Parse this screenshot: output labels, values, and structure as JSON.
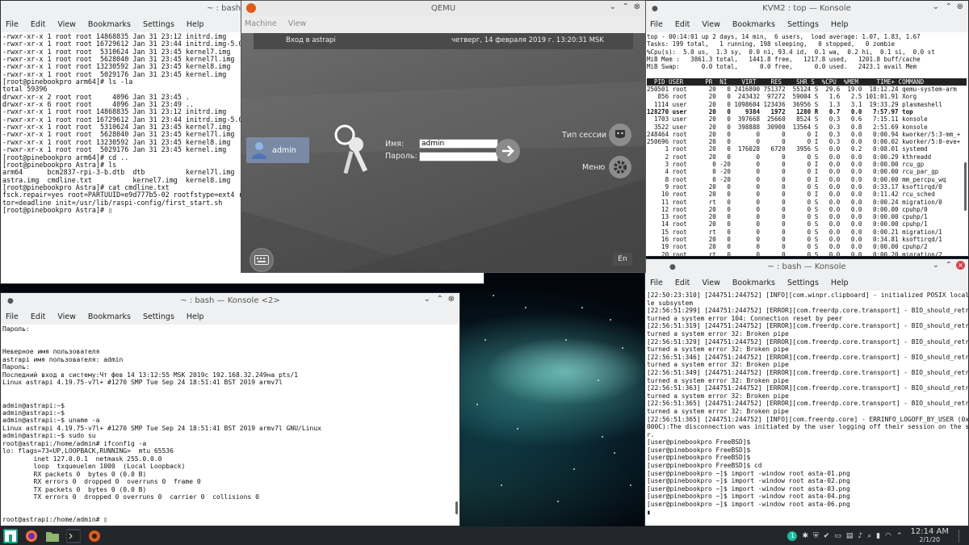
{
  "win_left_top": {
    "title": "~ : bash —",
    "menu": [
      "File",
      "Edit",
      "View",
      "Bookmarks",
      "Settings",
      "Help"
    ],
    "lines": [
      "-rwxr-xr-x 1 root root 14868835 Jan 31 23:12 initrd.img",
      "-rwxr-xr-x 1 root root 16729612 Jan 31 23:44 initrd.img-5.0.0-1017",
      "-rwxr-xr-x 1 root root  5310624 Jan 31 23:45 kernel7.img",
      "-rwxr-xr-x 1 root root  5628040 Jan 31 23:45 kernel7l.img",
      "-rwxr-xr-x 1 root root 13230592 Jan 31 23:45 kernel8.img",
      "-rwxr-xr-x 1 root root  5029176 Jan 31 23:45 kernel.img",
      "[root@pinebookpro arm64]# ls -la",
      "total 59396",
      "drwxr-xr-x 2 root root     4096 Jan 31 23:45 .",
      "drwxr-xr-x 6 root root     4096 Jan 31 23:49 ..",
      "-rwxr-xr-x 1 root root 14868835 Jan 31 23:12 initrd.img",
      "-rwxr-xr-x 1 root root 16729612 Jan 31 23:44 initrd.img-5.0.0-1017",
      "-rwxr-xr-x 1 root root  5310624 Jan 31 23:45 kernel7.img",
      "-rwxr-xr-x 1 root root  5628040 Jan 31 23:45 kernel7l.img",
      "-rwxr-xr-x 1 root root 13230592 Jan 31 23:45 kernel8.img",
      "-rwxr-xr-x 1 root root  5029176 Jan 31 23:45 kernel.img",
      "[root@pinebookpro arm64]# cd ..",
      "[root@pinebookpro Astra]# ls",
      "arm64      bcm2837-rpi-3-b.dtb  dtb          kernel7l.img  mnt1  o",
      "astra.img  cmdline.txt          kernel7.img  kernel8.img   mnt2  C",
      "[root@pinebookpro Astra]# cat cmdline.txt",
      "fsck.repair=yes root=PARTUUID=e9d777b5-02 rootfstype=ext4 rootwait",
      "tor=deadline init=/usr/lib/raspi-config/first_start.sh",
      "[root@pinebookpro Astra]# ▯"
    ]
  },
  "qemu": {
    "title": "QEMU",
    "menu": [
      "Machine",
      "View"
    ],
    "login_header": "Вход в astrapi",
    "datetime": "четверг, 14 февраля 2019 г. 13:20:31 MSK",
    "user_panel": "admin",
    "name_label": "Имя:",
    "password_label": "Пароль:",
    "name_value": "admin",
    "password_value": "",
    "session_type": "Тип сессии",
    "menu_label": "Меню",
    "lang": "En"
  },
  "win_top_right": {
    "title": "KVM2 : top — Konsole",
    "menu": [
      "File",
      "Edit",
      "View",
      "Bookmarks",
      "Settings",
      "Help"
    ],
    "header_lines": [
      "top - 00:14:01 up 2 days, 14 min,  6 users,  load average: 1.07, 1.83, 1.67",
      "Tasks: 199 total,   1 running, 198 sleeping,   0 stopped,   0 zombie",
      "%Cpu(s):  5.0 us,  1.3 sy,  0.0 ni, 93.4 id,  0.1 wa,  0.2 hi,  0.1 si,  0.0 st",
      "MiB Mem :   3861.3 total,   1441.8 free,   1217.8 used,   1201.8 buff/cache",
      "MiB Swap:      0.0 total,      0.0 free,      0.0 used.   2423.1 avail Mem"
    ],
    "table_header": "  PID USER      PR  NI    VIRT    RES    SHR S  %CPU  %MEM     TIME+ COMMAND",
    "rows": [
      "250501 root      20   0 2416800 751372  55124 S  29.6  19.0  18:12.24 qemu-system-arm",
      "   856 root      20   0  243432  97272  59004 S   1.6   2.5 101:01.91 Xorg",
      "  1114 user      20   0 1098604 123436  36956 S   1.3   3.1  19:33.29 plasmashell",
      "128270 user      20   0    9384   1972   1280 R   0.7   0.0   7:57.97 top",
      "  1703 user      20   0  397668  25660   8524 S   0.3   0.6   7:15.11 konsole",
      "  3522 user      20   0  398888  30900  13564 S   0.3   0.8   2:51.69 konsole",
      "248464 root      20   0       0      0      0 I   0.3   0.0   0:00.94 kworker/5:3-mm_+",
      "250696 root      20   0       0      0      0 I   0.3   0.0   0:00.02 kworker/5:0-eve+",
      "     1 root      20   0  176028   6720   3956 S   0.0   0.2   0:08.01 systemd",
      "     2 root      20   0       0      0      0 S   0.0   0.0   0:00.29 kthreadd",
      "     3 root       0 -20       0      0      0 I   0.0   0.0   0:00.00 rcu_gp",
      "     4 root       0 -20       0      0      0 I   0.0   0.0   0:00.00 rcu_par_gp",
      "     8 root       0 -20       0      0      0 I   0.0   0.0   0:00.00 mm_percpu_wq",
      "     9 root      20   0       0      0      0 S   0.0   0.0   0:33.17 ksoftirqd/0",
      "    10 root      20   0       0      0      0 I   0.0   0.0   0:11.42 rcu_sched",
      "    11 root      rt   0       0      0      0 S   0.0   0.0   0:00.24 migration/0",
      "    12 root      20   0       0      0      0 S   0.0   0.0   0:00.00 cpuhp/0",
      "    13 root      20   0       0      0      0 S   0.0   0.0   0:00.00 cpuhp/1",
      "    14 root      20   0       0      0      0 S   0.0   0.0   0:00.00 cpuhp/1",
      "    15 root      rt   0       0      0      0 S   0.0   0.0   0:00.21 migration/1",
      "    16 root      20   0       0      0      0 S   0.0   0.0   0:34.81 ksoftirqd/1",
      "    19 root      20   0       0      0      0 S   0.0   0.0   0:00.00 cpuhp/2",
      "    20 root      rt   0       0      0      0 S   0.0   0.0   0:00.20 migration/2"
    ]
  },
  "win_bottom_left": {
    "title": "~ : bash — Konsole <2>",
    "menu": [
      "File",
      "Edit",
      "View",
      "Bookmarks",
      "Settings",
      "Help"
    ],
    "lines": [
      "Пароль:",
      "",
      "",
      "Неверное имя пользователя",
      "astrapi имя пользователя: admin",
      "Пароль:",
      "Последний вход в систему:Чт фев 14 13:12:55 MSK 2019с 192.168.32.249на pts/1",
      "Linux astrapi 4.19.75-v7l+ #1270 SMP Tue Sep 24 18:51:41 BST 2019 armv7l",
      "",
      "",
      "admin@astrapi:~$",
      "admin@astrapi:~$",
      "admin@astrapi:~$ uname -a",
      "Linux astrapi 4.19.75-v7l+ #1270 SMP Tue Sep 24 18:51:41 BST 2019 armv7l GNU/Linux",
      "admin@astrapi:~$ sudo su",
      "root@astrapi:/home/admin# ifconfig -a",
      "lo: flags=73<UP,LOOPBACK,RUNNING>  mtu 65536",
      "        inet 127.0.0.1  netmask 255.0.0.0",
      "        loop  txqueuelen 1000  (Local Loopback)",
      "        RX packets 0  bytes 0 (0.0 B)",
      "        RX errors 0  dropped 0  overruns 0  frame 0",
      "        TX packets 0  bytes 0 (0.0 B)",
      "        TX errors 0  dropped 0 overruns 0  carrier 0  collisions 0",
      "",
      "",
      "root@astrapi:/home/admin# ▯"
    ]
  },
  "win_bottom_right": {
    "title": "~ : bash — Konsole",
    "menu": [
      "File",
      "Edit",
      "View",
      "Bookmarks",
      "Settings",
      "Help"
    ],
    "lines": [
      "[22:50:23:310] [244751:244752] [INFO][com.winpr.clipboard] - initialized POSIX local fi",
      "le subsystem",
      "[22:56:51:299] [244751:244752] [ERROR][com.freerdp.core.transport] - BIO_should_retry re",
      "turned a system error 104: Connection reset by peer",
      "[22:56:51:319] [244751:244752] [ERROR][com.freerdp.core.transport] - BIO_should_retry re",
      "turned a system error 32: Broken pipe",
      "[22:56:51:329] [244751:244752] [ERROR][com.freerdp.core.transport] - BIO_should_retry re",
      "turned a system error 32: Broken pipe",
      "[22:56:51:346] [244751:244752] [ERROR][com.freerdp.core.transport] - BIO_should_retry re",
      "turned a system error 32: Broken pipe",
      "[22:56:51:349] [244751:244752] [ERROR][com.freerdp.core.transport] - BIO_should_retry re",
      "turned a system error 32: Broken pipe",
      "[22:56:51:363] [244751:244752] [ERROR][com.freerdp.core.transport] - BIO_should_retry re",
      "turned a system error 32: Broken pipe",
      "[22:56:51:365] [244751:244752] [ERROR][com.freerdp.core.transport] - BIO_should_retry re",
      "turned a system error 32: Broken pipe",
      "[22:56:51:365] [244751:244752] [INFO][com.freerdp.core] - ERRINFO_LOGOFF_BY_USER (0x0000",
      "000C):The disconnection was initiated by the user logging off their session on the serve",
      "r.",
      "[user@pinebookpro FreeBSD]$",
      "[user@pinebookpro FreeBSD]$",
      "[user@pinebookpro FreeBSD]$",
      "[user@pinebookpro FreeBSD]$ cd",
      "[user@pinebookpro ~]$ import -window root asta-01.png",
      "[user@pinebookpro ~]$ import -window root asta-02.png",
      "[user@pinebookpro ~]$ import -window root asta-03.png",
      "[user@pinebookpro ~]$ import -window root asta-04.png",
      "[user@pinebookpro ~]$ import -window root asta-06.png",
      "▮"
    ]
  },
  "taskbar": {
    "time": "12:14 AM",
    "date": "2/1/20",
    "badge": "1"
  }
}
